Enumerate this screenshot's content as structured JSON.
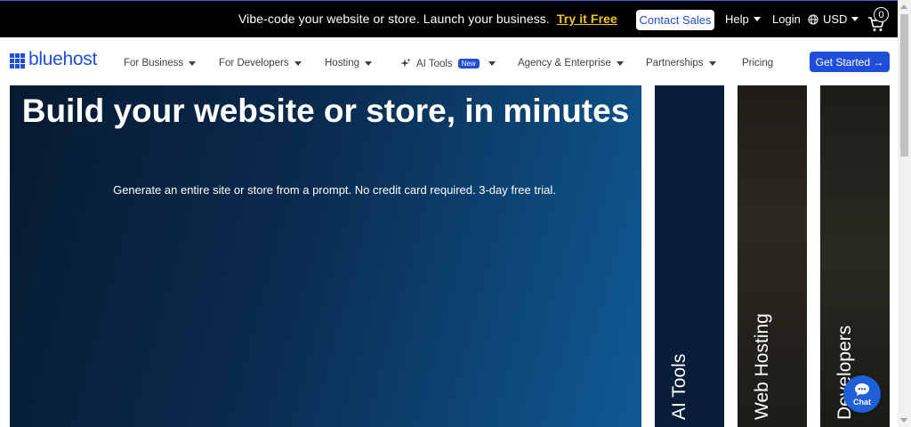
{
  "promo": {
    "text": "Vibe-code your website or store. Launch your business.",
    "cta": "Try it Free",
    "contact_sales": "Contact Sales",
    "help": "Help",
    "login": "Login",
    "currency": "USD",
    "cart_count": "0"
  },
  "nav": {
    "logo": "bluehost",
    "items": [
      {
        "label": "For Business",
        "dropdown": true
      },
      {
        "label": "For Developers",
        "dropdown": true
      },
      {
        "label": "Hosting",
        "dropdown": true
      },
      {
        "label": "AI Tools",
        "badge": "New",
        "dropdown": true
      },
      {
        "label": "Agency & Enterprise",
        "dropdown": true
      },
      {
        "label": "Partnerships",
        "dropdown": true
      },
      {
        "label": "Pricing",
        "dropdown": false
      }
    ],
    "cta": "Get Started →"
  },
  "hero": {
    "title": "Build your website or store, in minutes",
    "subtitle": "Generate an entire site or store from a prompt. No credit card required. 3-day free trial."
  },
  "cards": [
    {
      "label": "AI Tools"
    },
    {
      "label": "Web Hosting"
    },
    {
      "label": "Developers"
    }
  ],
  "chat": {
    "label": "Chat"
  },
  "colors": {
    "brand_blue": "#1f4ed8",
    "promo_accent": "#f5c518",
    "hero_dark": "#061a30",
    "hero_light": "#0f5a95"
  },
  "icons": [
    "ai-sparkle-icon",
    "globe-icon",
    "cart-icon",
    "chat-bubble-icon",
    "caret-down-icon"
  ]
}
